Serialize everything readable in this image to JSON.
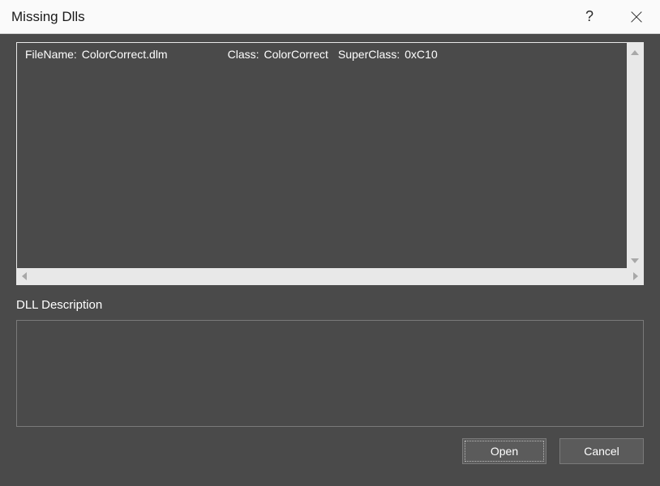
{
  "titlebar": {
    "title": "Missing Dlls",
    "help_label": "?"
  },
  "list": {
    "entries": [
      {
        "filename_label": "FileName:",
        "filename_value": "ColorCorrect.dlm",
        "class_label": "Class:",
        "class_value": "ColorCorrect",
        "superclass_label": "SuperClass:",
        "superclass_value": "0xC10"
      }
    ]
  },
  "description": {
    "heading": "DLL Description",
    "text": ""
  },
  "buttons": {
    "open": "Open",
    "cancel": "Cancel"
  }
}
